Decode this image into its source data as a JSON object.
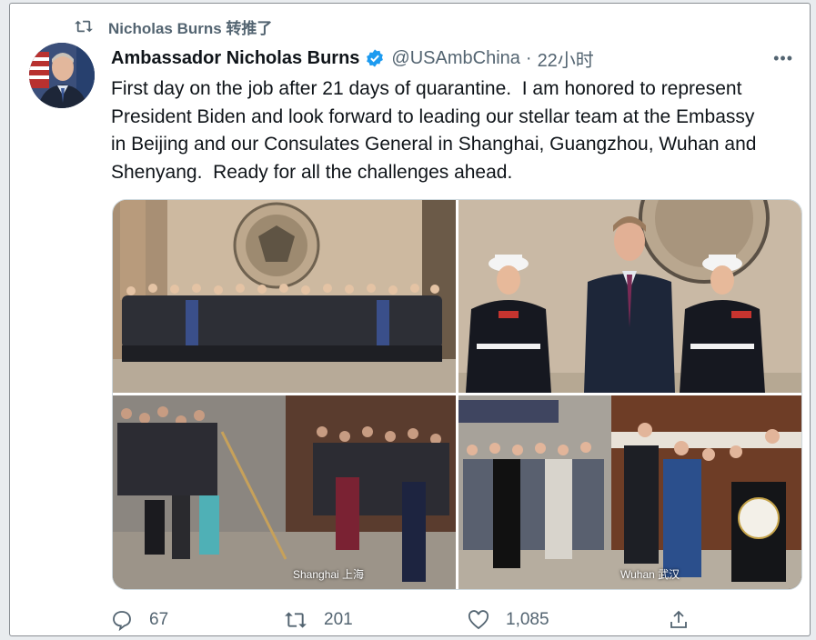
{
  "retweet": {
    "label": "Nicholas Burns 转推了",
    "icon": "retweet-icon"
  },
  "author": {
    "display_name": "Ambassador Nicholas Burns",
    "handle": "@USAmbChina",
    "separator": "·",
    "time": "22小时",
    "verified_color": "#1d9bf0"
  },
  "more_label": "•••",
  "tweet": {
    "text": "First day on the job after 21 days of quarantine.  I am honored to represent\nPresident Biden and look forward to leading our stellar team at the Embassy\nin Beijing and our Consulates General in Shanghai, Guangzhou, Wuhan and\nShenyang.  Ready for all the challenges ahead."
  },
  "media": {
    "photos": [
      {
        "caption": ""
      },
      {
        "caption": ""
      },
      {
        "caption": "Shanghai 上海"
      },
      {
        "caption": "Wuhan 武汉"
      }
    ]
  },
  "actions": {
    "replies": "67",
    "retweets": "201",
    "likes": "1,085"
  },
  "colors": {
    "text": "#0f1419",
    "muted": "#536471",
    "accent": "#1d9bf0"
  }
}
